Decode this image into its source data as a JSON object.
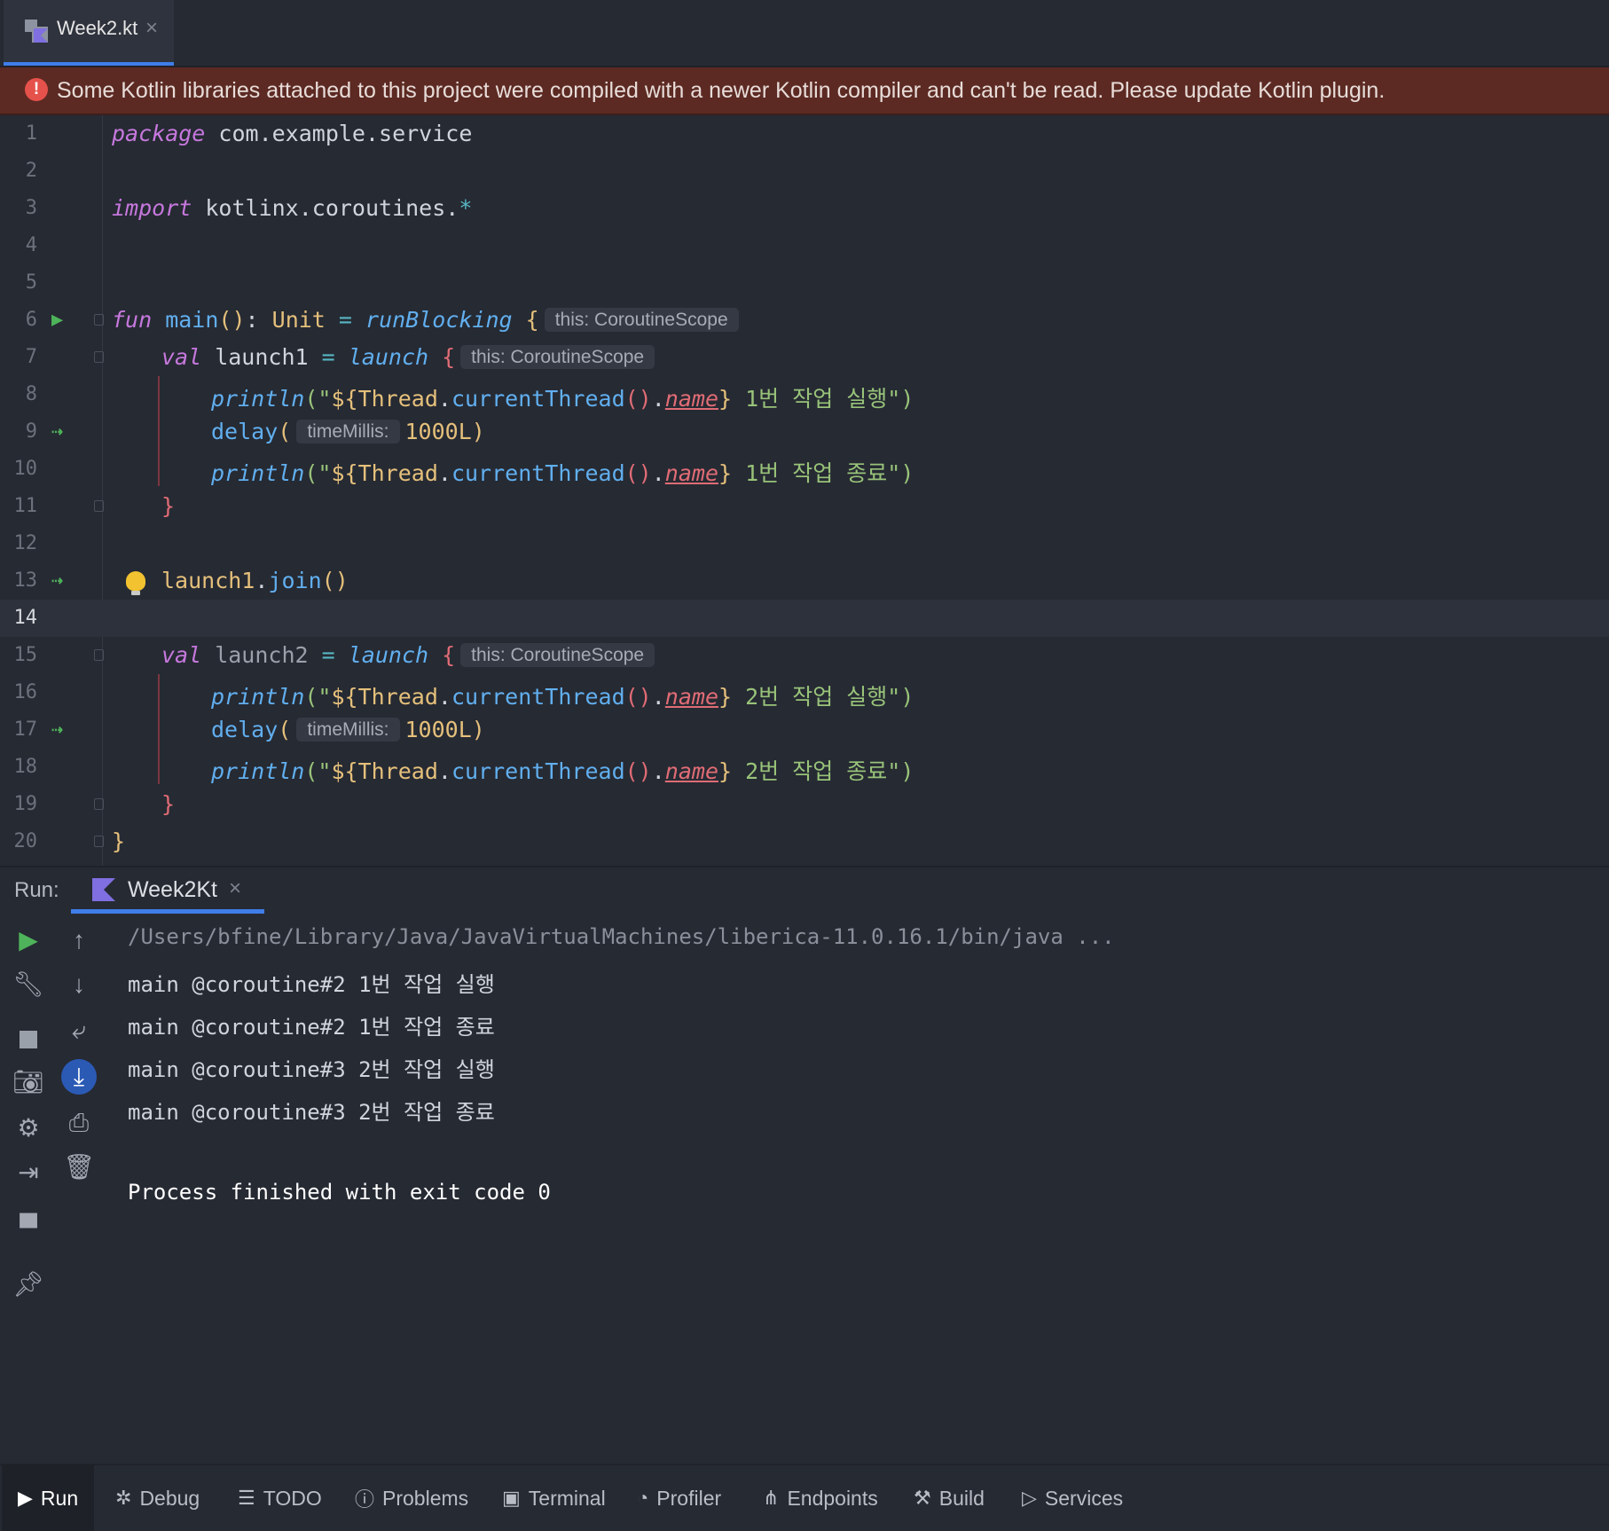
{
  "tab": {
    "label": "Week2.kt",
    "close": "×"
  },
  "banner": {
    "text": "Some Kotlin libraries attached to this project were compiled with a newer Kotlin compiler and can't be read. Please update Kotlin plugin."
  },
  "editor": {
    "current_line": 14,
    "line_numbers": [
      "1",
      "2",
      "3",
      "4",
      "5",
      "6",
      "7",
      "8",
      "9",
      "10",
      "11",
      "12",
      "13",
      "14",
      "15",
      "16",
      "17",
      "18",
      "19",
      "20"
    ],
    "code": {
      "l1_kw": "package",
      "l1_rest": " com.example.service",
      "l3_kw": "import",
      "l3_rest": " kotlinx.coroutines.",
      "l3_star": "*",
      "l6_fun": "fun",
      "l6_name": " main",
      "l6_parens": "()",
      "l6_colon": ": ",
      "l6_type": "Unit",
      "l6_eq": " = ",
      "l6_call": "runBlocking",
      "l6_brace": " {",
      "l6_hint": "this: CoroutineScope",
      "val_kw": "val",
      "l7_name": " launch1",
      "l15_name": " launch2",
      "eq": " = ",
      "launch": "launch",
      "open_brace": " {",
      "launch_hint": "this: CoroutineScope",
      "println": "println",
      "open_str": "(\"",
      "tpl_open": "${",
      "thread": "Thread",
      "dot": ".",
      "current_thread": "currentThread",
      "call_parens": "()",
      "name": "name",
      "tpl_close": "}",
      "l8_str": " 1번 작업 실행",
      "l10_str": " 1번 작업 종료",
      "l16_str": " 2번 작업 실행",
      "l18_str": " 2번 작업 종료",
      "close_str": "\")",
      "delay": "delay",
      "delay_open": "(",
      "delay_hint": "timeMillis:",
      "delay_val": "1000L",
      "delay_close": ")",
      "close_brace": "}",
      "l13_obj": "launch1",
      "l13_join": "join",
      "l13_parens": "()"
    }
  },
  "run": {
    "label": "Run:",
    "tab": {
      "label": "Week2Kt",
      "close": "×"
    },
    "output": [
      {
        "text": "/Users/bfine/Library/Java/JavaVirtualMachines/liberica-11.0.16.1/bin/java ...",
        "kind": "cmd"
      },
      {
        "text": "main @coroutine#2 1번 작업 실행",
        "kind": "out"
      },
      {
        "text": "main @coroutine#2 1번 작업 종료",
        "kind": "out"
      },
      {
        "text": "main @coroutine#3 2번 작업 실행",
        "kind": "out"
      },
      {
        "text": "main @coroutine#3 2번 작업 종료",
        "kind": "out"
      },
      {
        "text": "Process finished with exit code 0",
        "kind": "done"
      }
    ]
  },
  "bottom_tools": [
    {
      "label": "Run",
      "icon": "play-icon"
    },
    {
      "label": "Debug",
      "icon": "bug-icon"
    },
    {
      "label": "TODO",
      "icon": "list-icon"
    },
    {
      "label": "Problems",
      "icon": "alert-icon"
    },
    {
      "label": "Terminal",
      "icon": "terminal-icon"
    },
    {
      "label": "Profiler",
      "icon": "profiler-icon"
    },
    {
      "label": "Endpoints",
      "icon": "endpoints-icon"
    },
    {
      "label": "Build",
      "icon": "hammer-icon"
    },
    {
      "label": "Services",
      "icon": "services-icon"
    }
  ],
  "colors": {
    "accent": "#3f7ee8",
    "banner_bg": "#5c2a23",
    "error": "#e5514b",
    "run_green": "#4eb35a",
    "background": "#262a33"
  }
}
